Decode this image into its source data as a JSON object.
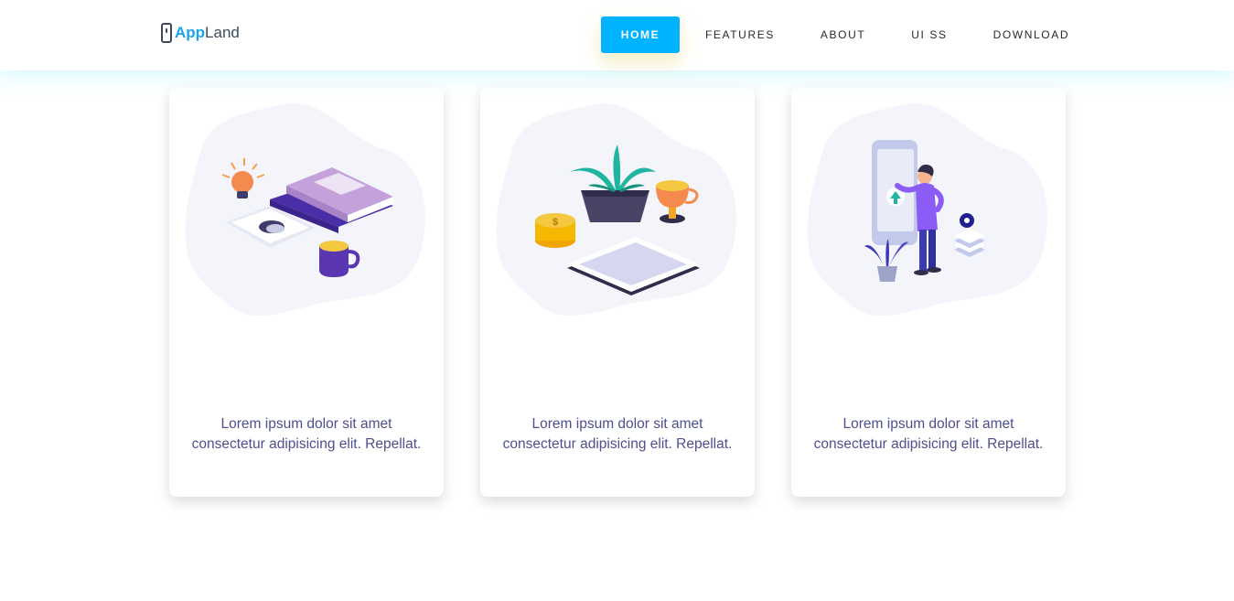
{
  "brand": {
    "part1": "App",
    "part2": "Land"
  },
  "nav": {
    "items": [
      {
        "label": "HOME",
        "active": true
      },
      {
        "label": "FEATURES",
        "active": false
      },
      {
        "label": "ABOUT",
        "active": false
      },
      {
        "label": "UI SS",
        "active": false
      },
      {
        "label": "DOWNLOAD",
        "active": false
      }
    ]
  },
  "cards": [
    {
      "illustration": "books-desk-illustration",
      "text": "Lorem ipsum dolor sit amet consectetur adipisicing elit. Repellat."
    },
    {
      "illustration": "plant-coins-tablet-illustration",
      "text": "Lorem ipsum dolor sit amet consectetur adipisicing elit. Repellat."
    },
    {
      "illustration": "person-phone-illustration",
      "text": "Lorem ipsum dolor sit amet consectetur adipisicing elit. Repellat."
    }
  ],
  "colors": {
    "accent": "#00b3ff",
    "logo_blue": "#1aa3e8",
    "text": "#4d4f8f",
    "blob": "#f4f4fb"
  }
}
